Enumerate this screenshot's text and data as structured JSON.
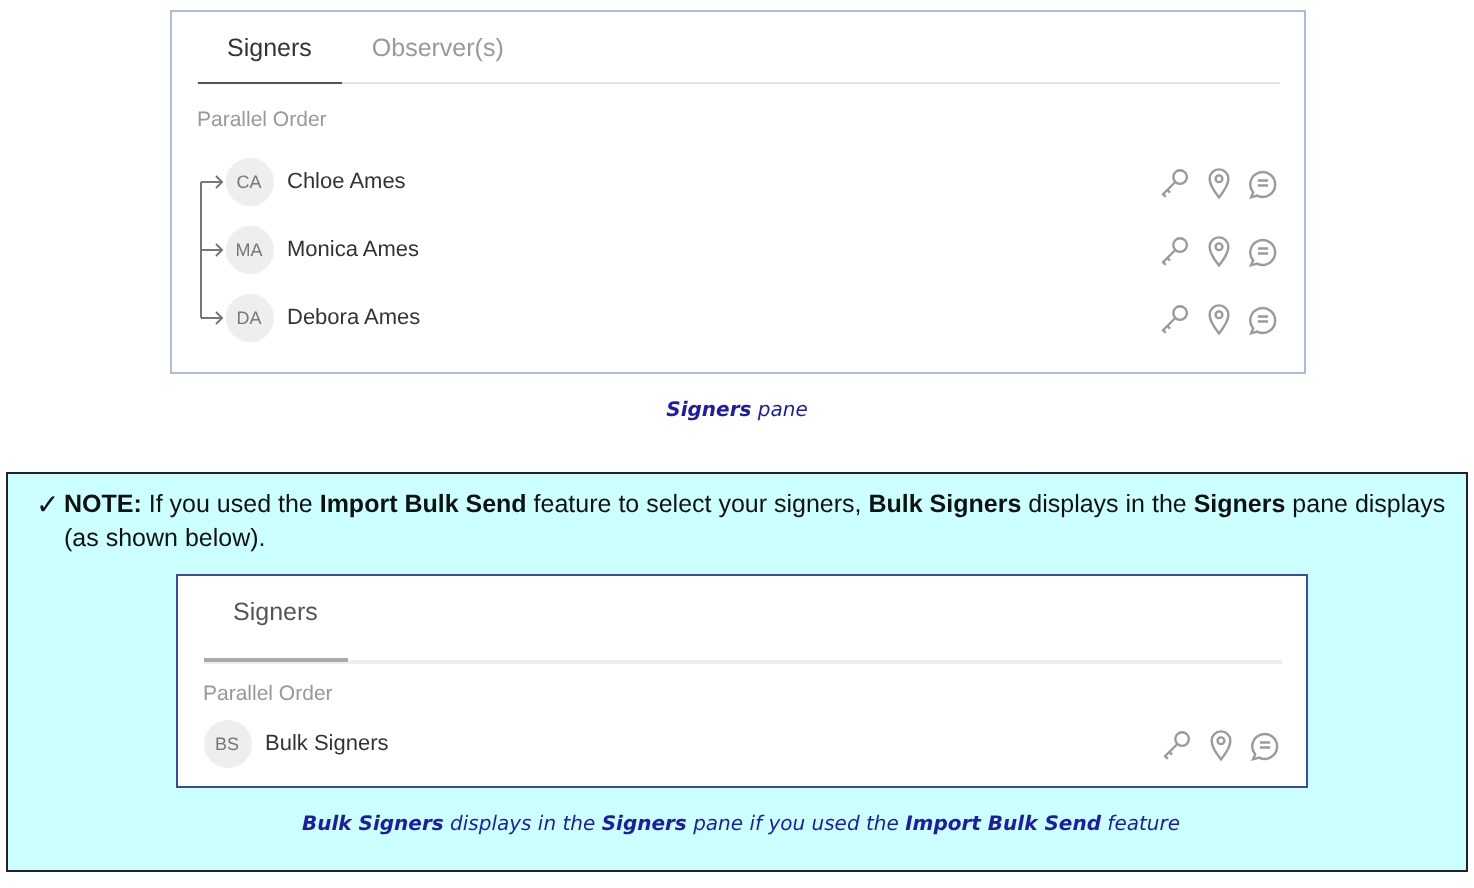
{
  "pane": {
    "tabs": [
      {
        "label": "Signers",
        "selected": true
      },
      {
        "label": "Observer(s)",
        "selected": false
      }
    ],
    "order_label": "Parallel Order",
    "signers": [
      {
        "initials": "CA",
        "name": "Chloe Ames"
      },
      {
        "initials": "MA",
        "name": "Monica Ames"
      },
      {
        "initials": "DA",
        "name": "Debora Ames"
      }
    ]
  },
  "caption": "**Signers** pane",
  "note": {
    "check": "✓",
    "text": "**NOTE:** If you used the **Import Bulk Send** feature to select your signers, **Bulk Signers** displays in the **Signers** pane displays (as shown below).",
    "pane": {
      "tabs": [
        {
          "label": "Signers",
          "selected": true
        }
      ],
      "order_label": "Parallel Order",
      "signers": [
        {
          "initials": "BS",
          "name": "Bulk Signers"
        }
      ]
    },
    "caption": "**Bulk Signers** displays in the **Signers** pane if you used the **Import Bulk Send** feature"
  }
}
